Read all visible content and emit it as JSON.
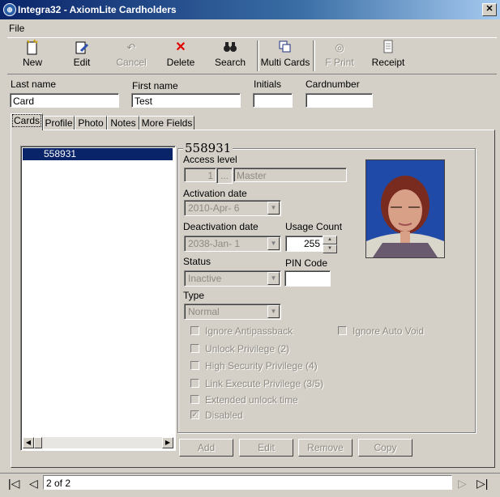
{
  "window": {
    "title": "Integra32 - AxiomLite Cardholders",
    "close_label": "✕"
  },
  "menu": {
    "file": "File"
  },
  "toolbar": {
    "new": "New",
    "edit": "Edit",
    "cancel": "Cancel",
    "delete": "Delete",
    "search": "Search",
    "multi_cards": "Multi Cards",
    "fprint": "F Print",
    "receipt": "Receipt"
  },
  "fields": {
    "last_name_label": "Last name",
    "last_name_value": "Card",
    "first_name_label": "First name",
    "first_name_value": "Test",
    "initials_label": "Initials",
    "initials_value": "",
    "cardnumber_label": "Cardnumber",
    "cardnumber_value": ""
  },
  "tabs": [
    "Cards",
    "Profile",
    "Photo",
    "Notes",
    "More Fields"
  ],
  "card_list": {
    "items": [
      "558931"
    ]
  },
  "card": {
    "number": "558931",
    "access_level_label": "Access level",
    "access_level_num": "1",
    "access_level_btn": "...",
    "access_level_name": "Master",
    "activation_label": "Activation date",
    "activation_value": "2010-Apr- 6",
    "deactivation_label": "Deactivation date",
    "deactivation_value": "2038-Jan- 1",
    "usage_label": "Usage Count",
    "usage_value": "255",
    "status_label": "Status",
    "status_value": "Inactive",
    "pin_label": "PIN Code",
    "pin_value": "",
    "type_label": "Type",
    "type_value": "Normal",
    "checks": {
      "ignore_antipassback": "Ignore Antipassback",
      "ignore_auto_void": "Ignore Auto Void",
      "unlock_privilege": "Unlock Privilege (2)",
      "high_security": "High Security Privilege (4)",
      "link_execute": "Link Execute Privilege (3/5)",
      "extended_unlock": "Extended unlock time",
      "disabled": "Disabled"
    },
    "disabled_checked": true
  },
  "panel_buttons": {
    "add": "Add",
    "edit": "Edit",
    "remove": "Remove",
    "copy": "Copy"
  },
  "nav": {
    "record": "2 of 2"
  },
  "colors": {
    "title_start": "#0a246a",
    "title_end": "#a6caf0",
    "face": "#d4d0c8",
    "selection": "#0a246a"
  }
}
